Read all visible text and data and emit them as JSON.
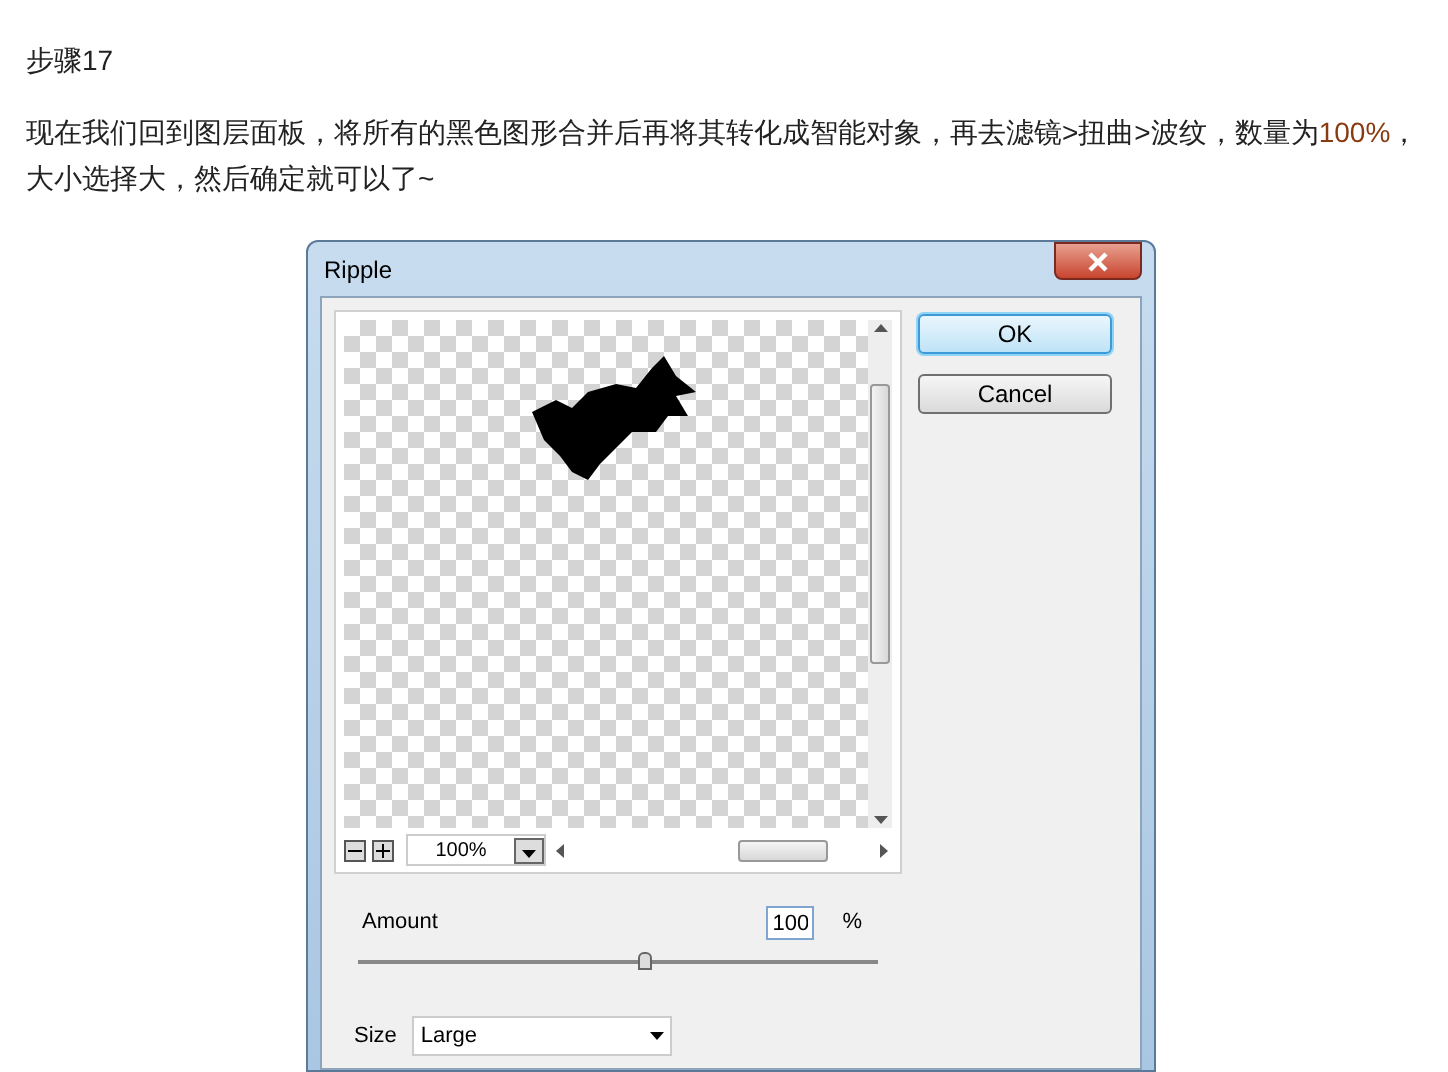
{
  "article": {
    "heading": "步骤17",
    "paragraph": {
      "before": "现在我们回到图层面板，将所有的黑色图形合并后再将其转化成智能对象，再去滤镜>扭曲>波纹，数量为",
      "highlight": "100%",
      "after": "，大小选择大，然后确定就可以了~"
    }
  },
  "dialog": {
    "title": "Ripple",
    "zoom": "100%",
    "buttons": [
      {
        "label": "OK",
        "default": true
      },
      {
        "label": "Cancel",
        "default": false
      }
    ],
    "amount": {
      "label": "Amount",
      "value": "100",
      "unit": "%",
      "level": 0.55
    },
    "size": {
      "label": "Size",
      "value": "Large"
    }
  }
}
